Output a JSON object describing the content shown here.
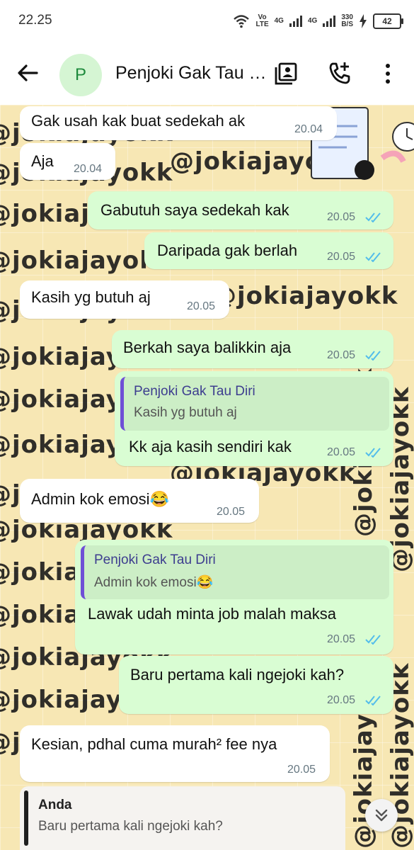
{
  "status_bar": {
    "time": "22.25",
    "volte": "Vo\nLTE",
    "net1": "4G",
    "net2": "4G",
    "speed": "330\nB/S",
    "battery": "42"
  },
  "header": {
    "avatar_letter": "P",
    "title": "Penjoki Gak Tau Diri"
  },
  "watermark": "@jokiajayokk",
  "messages": [
    {
      "side": "in",
      "text": "Gak usah kak buat sedekah ak",
      "time": "20.04"
    },
    {
      "side": "in",
      "text": "Aja",
      "time": "20.04"
    },
    {
      "side": "out",
      "text": "Gabutuh saya sedekah kak",
      "time": "20.05"
    },
    {
      "side": "out",
      "text": "Daripada gak berlah",
      "time": "20.05"
    },
    {
      "side": "in",
      "text": "Kasih yg butuh aj",
      "time": "20.05"
    },
    {
      "side": "out",
      "text": "Berkah saya balikkin aja",
      "time": "20.05"
    },
    {
      "side": "out",
      "quote_name": "Penjoki Gak Tau Diri",
      "quote_text": "Kasih yg butuh aj",
      "text": "Kk aja kasih sendiri kak",
      "time": "20.05"
    },
    {
      "side": "in",
      "text": "Admin kok emosi😂",
      "time": "20.05"
    },
    {
      "side": "out",
      "quote_name": "Penjoki Gak Tau Diri",
      "quote_text": "Admin kok emosi😂",
      "text": "Lawak udah minta job malah maksa",
      "time": "20.05"
    },
    {
      "side": "out",
      "text": "Baru pertama kali ngejoki kah?",
      "time": "20.05"
    },
    {
      "side": "in",
      "text": "Kesian, pdhal cuma murah² fee nya",
      "time": "20.05"
    }
  ],
  "reply_preview": {
    "name": "Anda",
    "text": "Baru pertama kali ngejoki kah?"
  },
  "colors": {
    "outgoing_bubble": "#d9fdd3",
    "incoming_bubble": "#ffffff",
    "read_tick": "#53bdeb",
    "chat_bg": "#f7e7b4"
  },
  "icons": {
    "back": "arrow-left",
    "contact_card": "contact-card",
    "call": "phone-add",
    "menu": "more-vertical",
    "scroll": "double-chevron-down"
  }
}
